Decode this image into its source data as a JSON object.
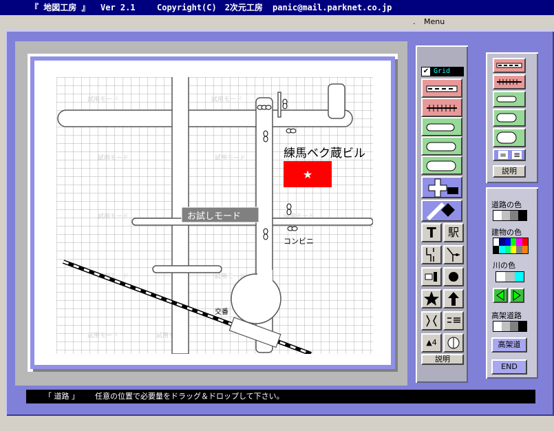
{
  "title_bar": {
    "app_name": "『 地図工房 』",
    "version": "Ver 2.1",
    "copyright": "Copyright(C)　2次元工房",
    "email": "panic@mail.parknet.co.jp"
  },
  "menu_bar": {
    "dot": ".",
    "menu_label": "Menu"
  },
  "map": {
    "watermark": "試用モード",
    "trial_mode_label": "お試しモード",
    "building_label": "練馬ベク蔵ビル",
    "building_marker": "★",
    "convenience_store_label": "コンビニ",
    "police_box_label": "交番",
    "building_color": "#ff0000",
    "road_color": "#ffffff"
  },
  "tool_panel": {
    "grid_checkbox_checked": true,
    "grid_label": "Grid",
    "text_tool_glyph": "T",
    "station_tool_label": "駅",
    "number_tool_label": "▲4",
    "help_label": "説明"
  },
  "road_style_panel": {
    "help_label": "説明",
    "equal_glyph_1": "=",
    "equal_glyph_2": "≡"
  },
  "color_panel": {
    "road_color_label": "道路の色",
    "building_color_label": "建物の色",
    "river_color_label": "川の色",
    "elevated_road_label": "高架道路",
    "elevated_road_button": "高架道",
    "end_button": "END",
    "road_color_swatches": [
      "#ffffff",
      "#c0c0c0",
      "#808080",
      "#000000"
    ],
    "building_color_swatches_top": [
      "#ffffff",
      "#000080",
      "#0000ff",
      "#00ff00",
      "#ff00ff",
      "#ff0000"
    ],
    "building_color_swatches_bottom": [
      "#000000",
      "#00ffff",
      "#00ff80",
      "#ffff00",
      "#808080",
      "#ff8000"
    ],
    "river_color_swatches": [
      "#ffffff",
      "#c0c0c0",
      "#00ffff"
    ],
    "elevated_road_swatches": [
      "#ffffff",
      "#c0c0c0",
      "#808080",
      "#000000"
    ]
  },
  "status_bar": {
    "mode": "「 道路 」",
    "message": "任意の位置で必要量をドラッグ＆ドロップして下さい。"
  }
}
